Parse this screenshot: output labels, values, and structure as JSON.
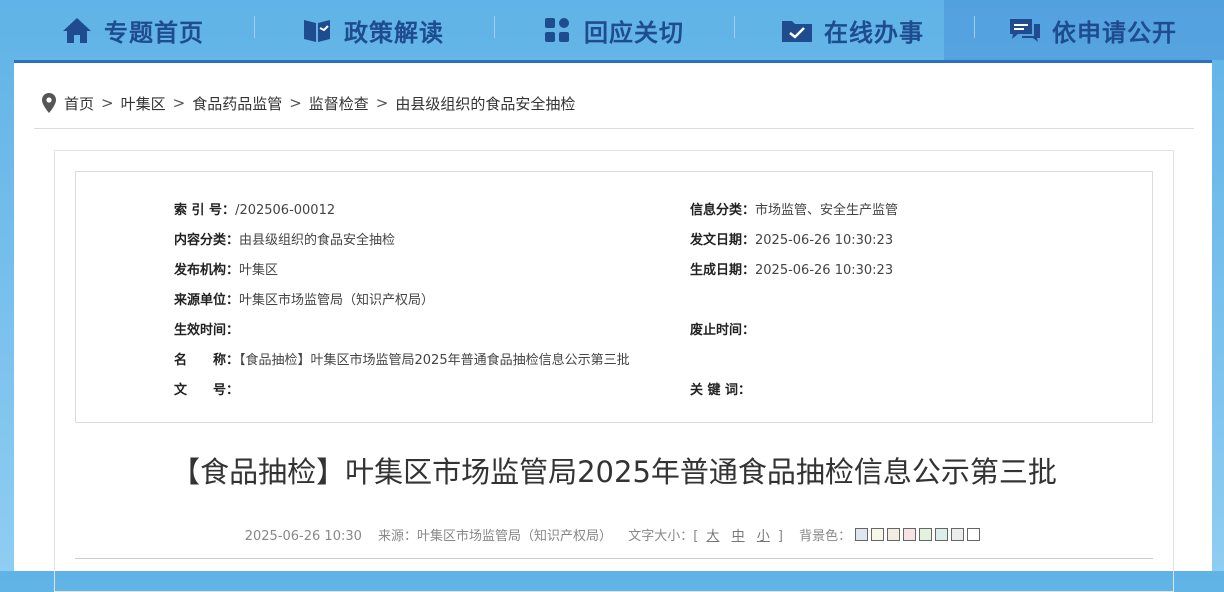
{
  "nav": {
    "items": [
      {
        "label": "专题首页",
        "icon": "home-icon"
      },
      {
        "label": "政策解读",
        "icon": "book-icon"
      },
      {
        "label": "回应关切",
        "icon": "grid-icon"
      },
      {
        "label": "在线办事",
        "icon": "folder-check-icon"
      },
      {
        "label": "依申请公开",
        "icon": "chat-icon"
      }
    ]
  },
  "breadcrumb": {
    "items": [
      "首页",
      "叶集区",
      "食品药品监管",
      "监督检查",
      "由县级组织的食品安全抽检"
    ],
    "separator": ">"
  },
  "meta": {
    "left": [
      {
        "key": "索 引 号：",
        "value": "/202506-00012"
      },
      {
        "key": "内容分类：",
        "value": "由县级组织的食品安全抽检"
      },
      {
        "key": "发布机构：",
        "value": "叶集区"
      },
      {
        "key": "来源单位：",
        "value": "叶集区市场监管局（知识产权局）"
      },
      {
        "key": "生效时间：",
        "value": ""
      },
      {
        "key": "名　　称：",
        "value": "【食品抽检】叶集区市场监管局2025年普通食品抽检信息公示第三批"
      },
      {
        "key": "文　　号：",
        "value": ""
      }
    ],
    "right": [
      {
        "key": "信息分类：",
        "value": "市场监管、安全生产监管"
      },
      {
        "key": "发文日期：",
        "value": "2025-06-26 10:30:23"
      },
      {
        "key": "生成日期：",
        "value": "2025-06-26 10:30:23"
      },
      {
        "key": "废止时间：",
        "value": ""
      },
      {
        "key": "关 键 词：",
        "value": ""
      }
    ]
  },
  "article": {
    "title": "【食品抽检】叶集区市场监管局2025年普通食品抽检信息公示第三批",
    "date": "2025-06-26 10:30",
    "source_label": "来源：",
    "source": "叶集区市场监管局（知识产权局）",
    "font_size_label": "文字大小：[",
    "font_sizes": [
      "大",
      "中",
      "小"
    ],
    "font_size_close": "]",
    "bg_label": "背景色：",
    "bg_colors": [
      "#dfe6f0",
      "#f7f7e8",
      "#f3ece3",
      "#f7e3e6",
      "#e3f2dc",
      "#dbefe8",
      "#ececec",
      "#ffffff"
    ]
  }
}
